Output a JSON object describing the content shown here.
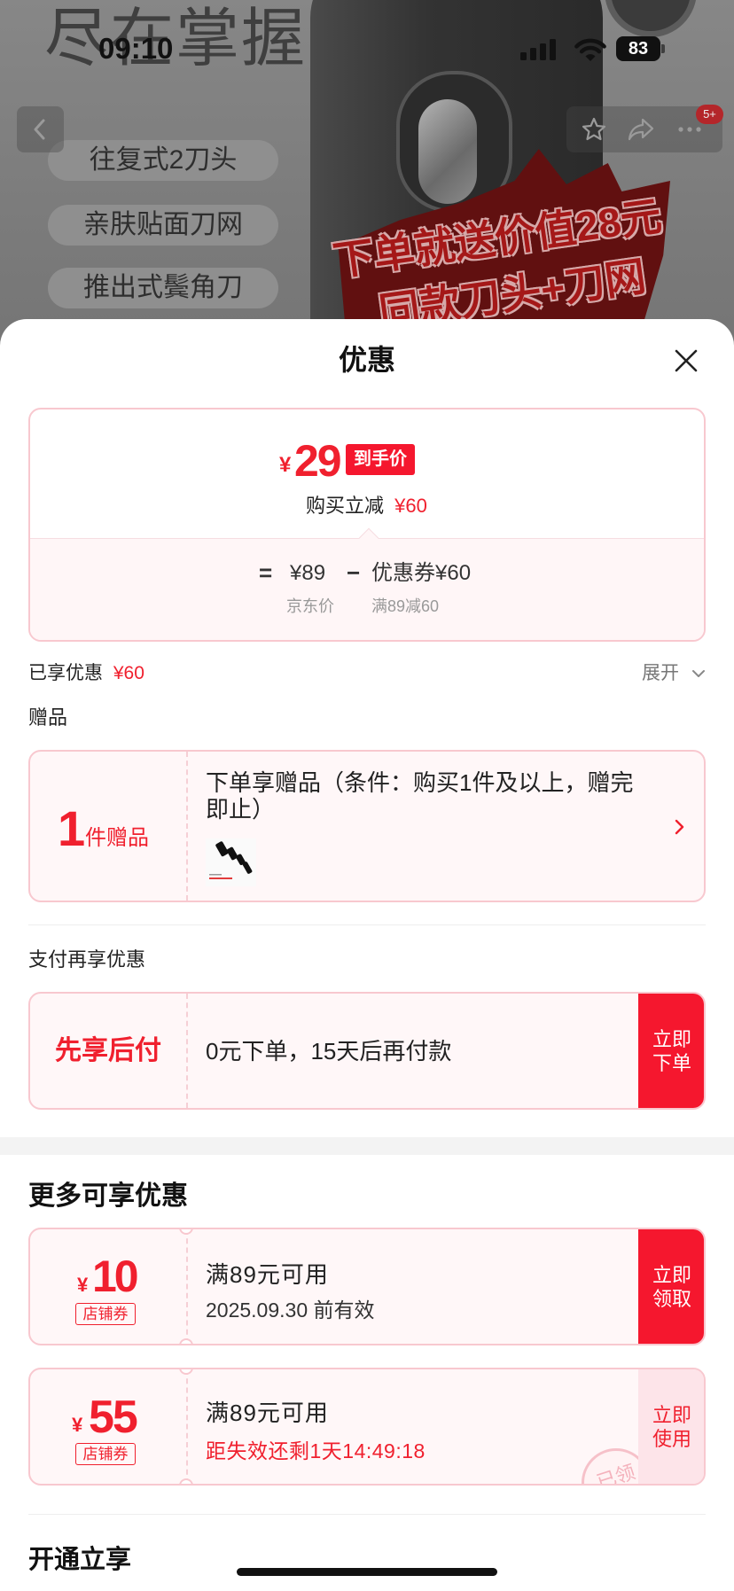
{
  "status_bar": {
    "time": "09:10",
    "battery": "83"
  },
  "product_bg": {
    "headline": "尽在掌握",
    "features": [
      "往复式2刀头",
      "亲肤贴面刀网",
      "推出式鬓角刀"
    ],
    "promo": [
      "下单就送价值28元",
      "同款刀头+刀网"
    ]
  },
  "nav": {
    "badge": "5+",
    "icons": [
      "chevron-left-icon",
      "star-icon",
      "share-icon",
      "more-icon"
    ]
  },
  "sheet": {
    "title": "优惠",
    "close_icon": "close-icon",
    "price_card": {
      "currency": "¥",
      "final_price": "29",
      "final_tag": "到手价",
      "instant_label": "购买立减",
      "instant_amount": "¥60",
      "eq": "=",
      "jd_price": "¥89",
      "minus": "−",
      "coupon_formula": "优惠券¥60",
      "jd_label": "京东价",
      "coupon_rule": "满89减60"
    },
    "enjoyed": {
      "label": "已享优惠",
      "amount": "¥60",
      "expand": "展开"
    },
    "gift": {
      "section_title": "赠品",
      "count": "1",
      "count_unit": "件赠品",
      "description": "下单享赠品（条件：购买1件及以上，赠完即止）"
    },
    "pay_later": {
      "section_title": "支付再享优惠",
      "name": "先享后付",
      "description": "0元下单，15天后再付款",
      "button": [
        "立即",
        "下单"
      ]
    },
    "more_offers": {
      "section_title": "更多可享优惠",
      "coupons": [
        {
          "currency": "¥",
          "amount": "10",
          "tag": "店铺券",
          "condition": "满89元可用",
          "validity": "2025.09.30 前有效",
          "button": [
            "立即",
            "领取"
          ]
        },
        {
          "currency": "¥",
          "amount": "55",
          "tag": "店铺券",
          "condition": "满89元可用",
          "validity": "距失效还剩1天14:49:18",
          "button": [
            "立即",
            "使用"
          ],
          "stamp": "已领"
        }
      ]
    },
    "membership": {
      "section_title": "开通立享"
    }
  },
  "colors": {
    "accent": "#f0202e",
    "button_red": "#f5172e",
    "card_border": "#f8c8cf",
    "card_bg": "#fff7f8"
  }
}
